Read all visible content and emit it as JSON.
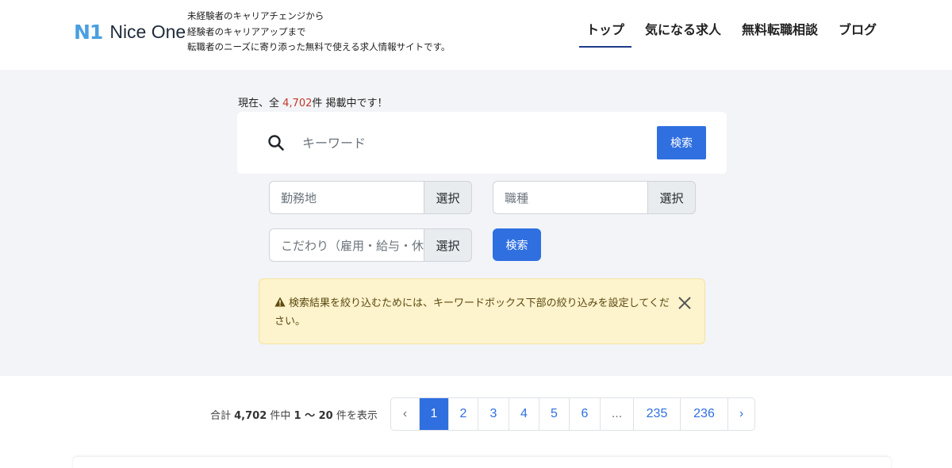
{
  "header": {
    "logo_mark": "N1",
    "logo_text": "Nice One",
    "tagline": [
      "未経験者のキャリアチェンジから",
      "経験者のキャリアアップまで",
      "転職者のニーズに寄り添った無料で使える求人情報サイトです。"
    ],
    "nav": [
      {
        "label": "トップ",
        "active": true
      },
      {
        "label": "気になる求人",
        "active": false
      },
      {
        "label": "無料転職相談",
        "active": false
      },
      {
        "label": "ブログ",
        "active": false
      }
    ]
  },
  "search": {
    "count_prefix": "現在、全 ",
    "count_value": "4,702",
    "count_suffix": "件 掲載中です！",
    "keyword_placeholder": "キーワード",
    "search_label": "検索",
    "filters": {
      "location_placeholder": "勤務地",
      "job_type_placeholder": "職種",
      "preferences_placeholder": "こだわり（雇用・給与・休日など）",
      "select_label": "選択"
    },
    "filter_search_label": "検索"
  },
  "alert": {
    "text": "検索結果を絞り込むためには、キーワードボックス下部の絞り込みを設定してください。"
  },
  "pagination": {
    "total_prefix": "合計 ",
    "total": "4,702",
    "range_mid": " 件中 ",
    "range": "1 〜 20",
    "range_suffix": " 件を表示",
    "prev": "‹",
    "next": "›",
    "pages": [
      "1",
      "2",
      "3",
      "4",
      "5",
      "6",
      "...",
      "235",
      "236"
    ],
    "current": "1"
  },
  "colors": {
    "accent": "#2f6fe0",
    "logo": "#4a9fe0",
    "count_highlight": "#c0392b",
    "alert_bg": "#fdf3cd"
  }
}
